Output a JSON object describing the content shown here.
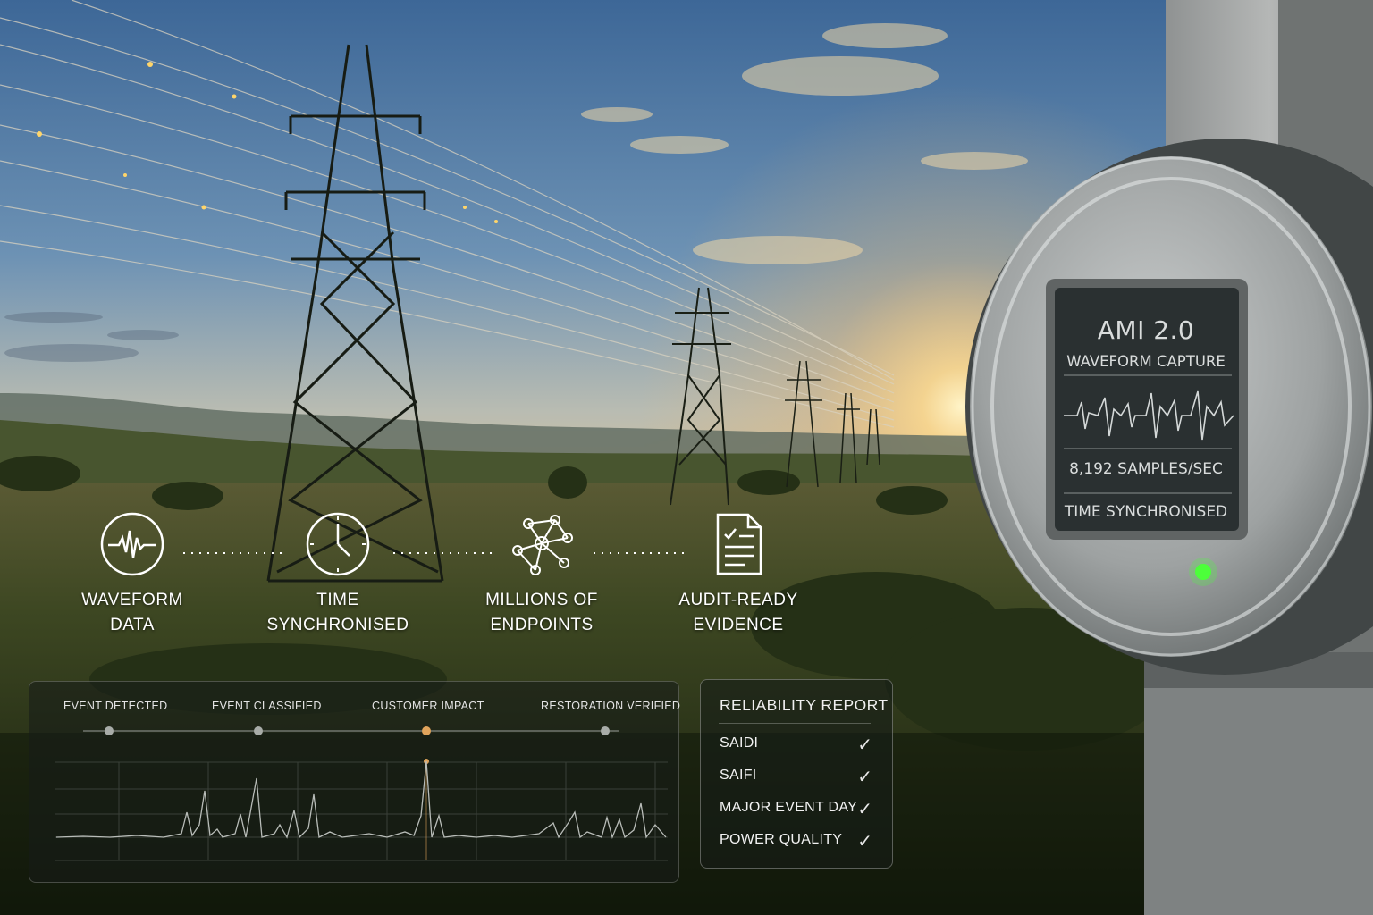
{
  "features": [
    {
      "icon": "waveform-icon",
      "line1": "WAVEFORM",
      "line2": "DATA"
    },
    {
      "icon": "clock-icon",
      "line1": "TIME",
      "line2": "SYNCHRONISED"
    },
    {
      "icon": "network-nodes-icon",
      "line1": "MILLIONS OF",
      "line2": "ENDPOINTS"
    },
    {
      "icon": "document-check-icon",
      "line1": "AUDIT-READY",
      "line2": "EVIDENCE"
    }
  ],
  "timeline": {
    "stages": [
      "EVENT DETECTED",
      "EVENT CLASSIFIED",
      "CUSTOMER IMPACT",
      "RESTORATION VERIFIED"
    ],
    "highlight_color": "#e0a45c"
  },
  "report": {
    "title": "RELIABILITY REPORT",
    "items": [
      {
        "label": "SAIDI",
        "status": "✓"
      },
      {
        "label": "SAIFI",
        "status": "✓"
      },
      {
        "label": "MAJOR EVENT DAY",
        "status": "✓"
      },
      {
        "label": "POWER QUALITY",
        "status": "✓"
      }
    ]
  },
  "meter": {
    "title": "AMI 2.0",
    "subtitle": "WAVEFORM CAPTURE",
    "rate": "8,192 SAMPLES/SEC",
    "sync": "TIME SYNCHRONISED",
    "led_color": "#4cff3a"
  }
}
